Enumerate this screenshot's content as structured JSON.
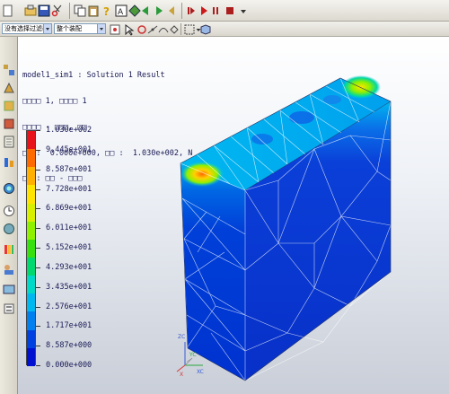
{
  "toolbar_top": {
    "icons": [
      "new-icon",
      "open-icon",
      "save-icon",
      "cut-icon",
      "copy-icon",
      "paste-icon",
      "undo-icon",
      "redo-icon",
      "measure-icon",
      "help-icon",
      "select-icon",
      "expand-icon",
      "layer-icon",
      "arrow-left-icon",
      "arrow-right-icon",
      "play-back-icon",
      "play-forward-icon",
      "record-icon",
      "stop-icon",
      "menu-icon"
    ]
  },
  "toolbar_filter": {
    "type_filter": "没有选择过滤器",
    "scope": "整个装配"
  },
  "header": {
    "line1": "model1_sim1 : Solution 1 Result",
    "line2": "□□□□ 1, □□□□ 1",
    "line3": "□□□□ - □□□, □□",
    "line4": "□□ :  0.000e+000, □□ :  1.030e+002, N",
    "line5": "□□ : □□ - □□□"
  },
  "legend": {
    "labels": [
      "1.030e+002",
      "9.445e+001",
      "8.587e+001",
      "7.728e+001",
      "6.869e+001",
      "6.011e+001",
      "5.152e+001",
      "4.293e+001",
      "3.435e+001",
      "2.576e+001",
      "1.717e+001",
      "8.587e+000",
      "0.000e+000"
    ],
    "colors": [
      "#e8121b",
      "#ff6a00",
      "#ffb000",
      "#ffe400",
      "#d8f000",
      "#8ff000",
      "#38e010",
      "#00d870",
      "#00d8c8",
      "#00b8f0",
      "#0080f0",
      "#0040e0",
      "#0010d0"
    ]
  },
  "triad": {
    "zc": "ZC",
    "yc": "YC",
    "xc": "XC",
    "x": "X"
  }
}
